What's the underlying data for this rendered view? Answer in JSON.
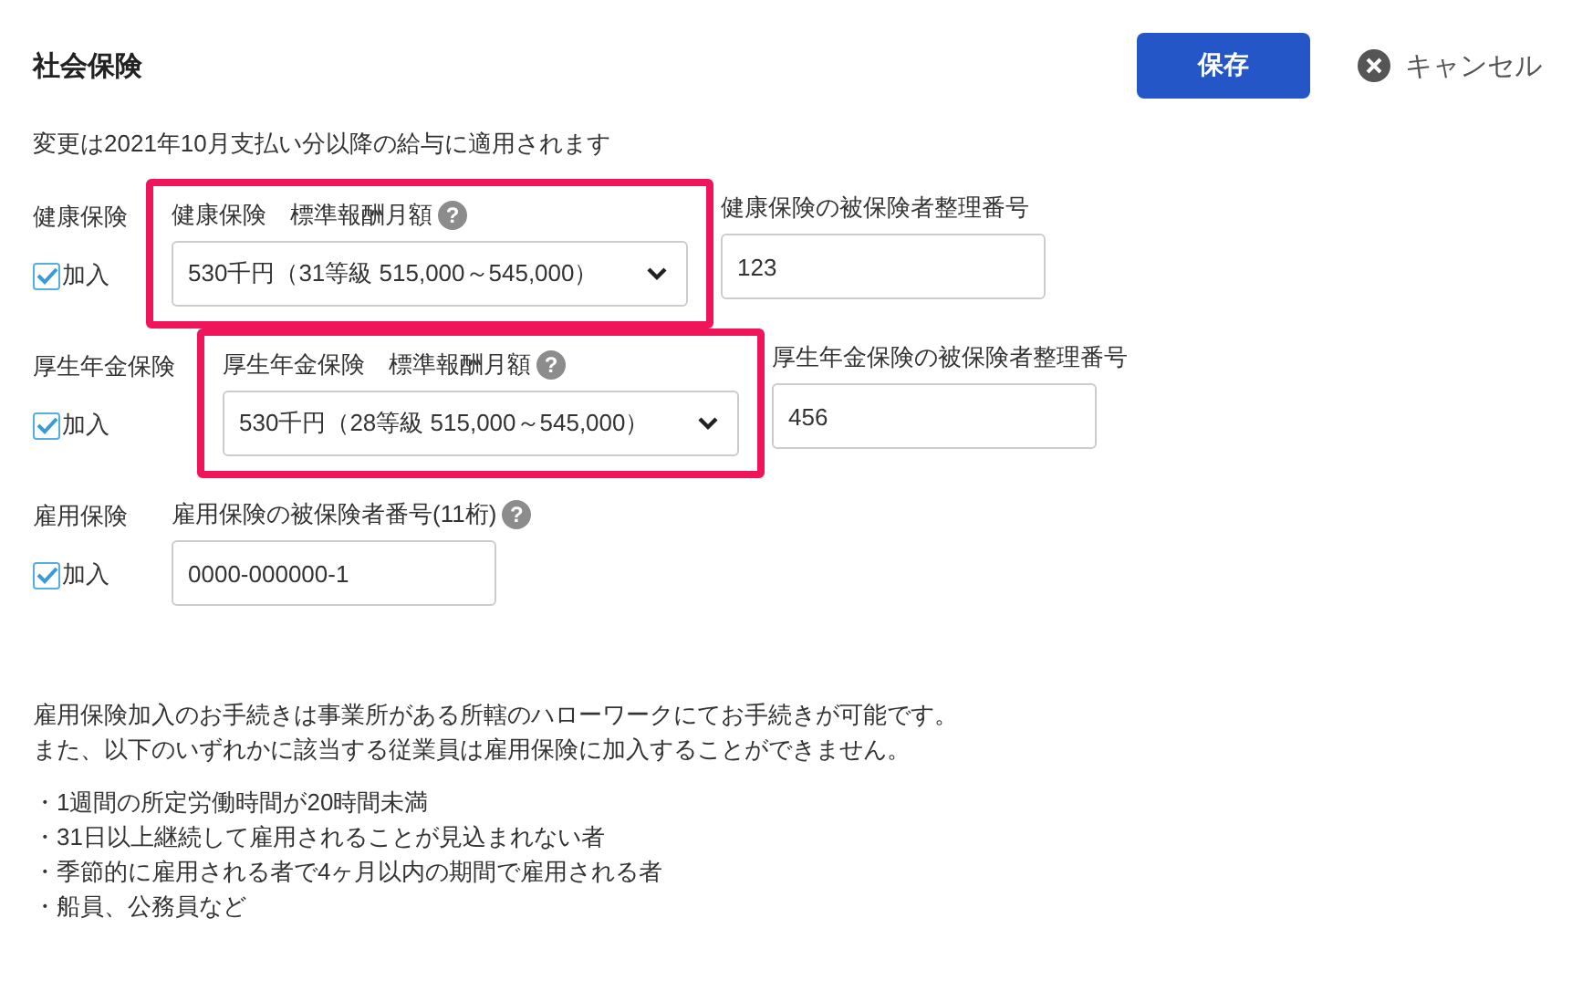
{
  "header": {
    "title": "社会保険",
    "save": "保存",
    "cancel": "キャンセル"
  },
  "notice": "変更は2021年10月支払い分以降の給与に適用されます",
  "sections": [
    {
      "name": "健康保険",
      "enrolled": {
        "label": "加入",
        "checked": true
      },
      "fields": [
        {
          "kind": "select",
          "label": "健康保険　標準報酬月額",
          "help": "?",
          "value": "530千円（31等級 515,000～545,000）",
          "highlighted": true
        },
        {
          "kind": "text",
          "label": "健康保険の被保険者整理番号",
          "value": "123",
          "highlighted": false
        }
      ]
    },
    {
      "name": "厚生年金保険",
      "enrolled": {
        "label": "加入",
        "checked": true
      },
      "fields": [
        {
          "kind": "select",
          "label": "厚生年金保険　標準報酬月額",
          "help": "?",
          "value": "530千円（28等級 515,000～545,000）",
          "highlighted": true
        },
        {
          "kind": "text",
          "label": "厚生年金保険の被保険者整理番号",
          "value": "456",
          "highlighted": false
        }
      ]
    },
    {
      "name": "雇用保険",
      "enrolled": {
        "label": "加入",
        "checked": true
      },
      "fields": [
        {
          "kind": "text",
          "label": "雇用保険の被保険者番号(11桁)",
          "help": "?",
          "value": "0000-000000-1",
          "highlighted": false
        }
      ]
    }
  ],
  "info": [
    "雇用保険加入のお手続きは事業所がある所轄のハローワークにてお手続きが可能です。",
    "また、以下のいずれかに該当する従業員は雇用保険に加入することができません。"
  ],
  "conditions": [
    "・1週間の所定労働時間が20時間未満",
    "・31日以上継続して雇用されることが見込まれない者",
    "・季節的に雇用される者で4ヶ月以内の期間で雇用される者",
    "・船員、公務員など"
  ]
}
